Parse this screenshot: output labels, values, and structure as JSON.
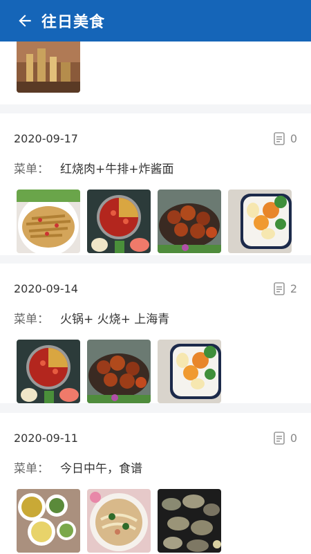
{
  "header": {
    "title": "往日美食"
  },
  "records": [
    {
      "date": "2020-09-17",
      "count": "0",
      "menu_label": "菜单：",
      "menu": "红烧肉+牛排+炸酱面",
      "photos": [
        "fries-photo",
        "hotpot-photo",
        "braised-pork-photo",
        "egg-dish-photo"
      ]
    },
    {
      "date": "2020-09-14",
      "count": "2",
      "menu_label": "菜单：",
      "menu": "火锅+ 火烧+ 上海青",
      "photos": [
        "hotpot-photo",
        "braised-pork-photo",
        "egg-dish-photo"
      ]
    },
    {
      "date": "2020-09-11",
      "count": "0",
      "menu_label": "菜单：",
      "menu": "今日中午，食谱",
      "photos": [
        "plates-photo",
        "noodle-soup-photo",
        "oyster-photo"
      ]
    }
  ],
  "colors": {
    "brand": "#1565b8",
    "background": "#f4f5f7"
  },
  "icons": {
    "back": "arrow-left-icon",
    "note": "document-icon"
  }
}
